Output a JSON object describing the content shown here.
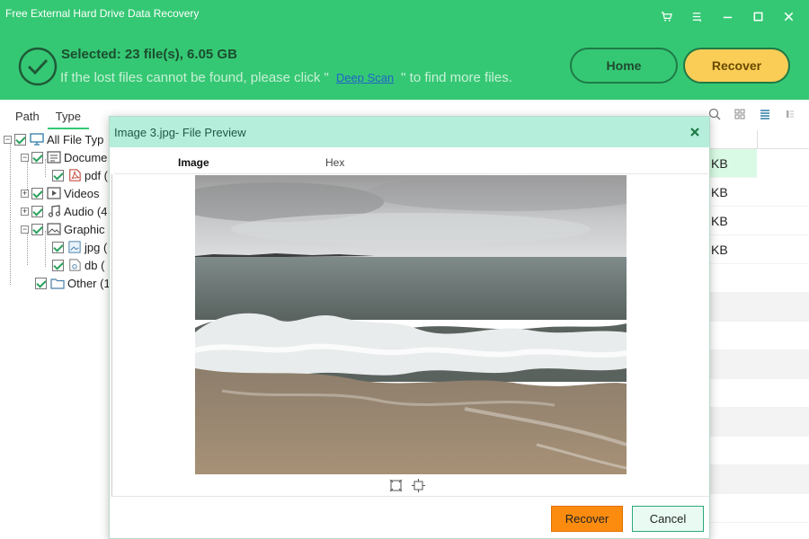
{
  "app": {
    "title": "Free External Hard Drive Data Recovery"
  },
  "window_controls": [
    "cart-icon",
    "menu-icon",
    "minimize-icon",
    "maximize-icon",
    "close-icon"
  ],
  "status": {
    "selected": "Selected: 23 file(s), 6.05 GB",
    "hint_before": "If the lost files cannot be found, please click \"",
    "deep_scan": "Deep Scan",
    "hint_after": "\" to find more files."
  },
  "header_buttons": {
    "home": "Home",
    "recover": "Recover"
  },
  "left_tabs": [
    "Path",
    "Type"
  ],
  "tree": [
    {
      "label": "All File Typ",
      "icon": "monitor-icon",
      "expander": "−"
    },
    {
      "label": "Docume",
      "icon": "document-icon",
      "expander": "−"
    },
    {
      "label": "pdf (",
      "icon": "pdf-icon",
      "expander": ""
    },
    {
      "label": "Videos",
      "icon": "video-icon",
      "expander": "+"
    },
    {
      "label": "Audio (4",
      "icon": "music-icon",
      "expander": "+"
    },
    {
      "label": "Graphic",
      "icon": "image-icon",
      "expander": "−"
    },
    {
      "label": "jpg (",
      "icon": "jpg-file-icon",
      "expander": ""
    },
    {
      "label": "db (",
      "icon": "db-file-icon",
      "expander": ""
    },
    {
      "label": "Other (1",
      "icon": "folder-icon",
      "expander": ""
    }
  ],
  "file_sizes": [
    "KB",
    "KB",
    "KB",
    "KB"
  ],
  "dialog": {
    "title": "Image 3.jpg- File Preview",
    "tabs": {
      "image": "Image",
      "hex": "Hex"
    },
    "recover": "Recover",
    "cancel": "Cancel"
  },
  "colors": {
    "header": "#35c874",
    "accent_orange": "#fb8c10",
    "recover_yellow": "#f9cd56",
    "dialog_title": "#b5eedb"
  }
}
